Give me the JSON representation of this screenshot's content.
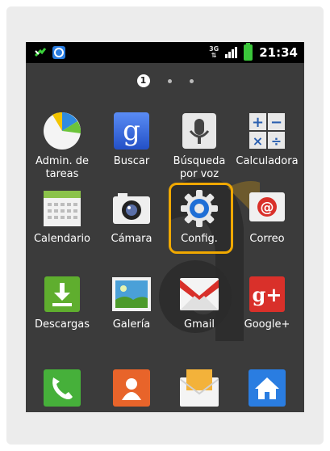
{
  "status_bar": {
    "network": "3G",
    "time": "21:34"
  },
  "pager": {
    "current_page": "1"
  },
  "apps": [
    {
      "label": "Admin. de tareas",
      "icon": "pie-chart-icon"
    },
    {
      "label": "Buscar",
      "icon": "google-search-icon"
    },
    {
      "label": "Búsqueda por voz",
      "icon": "microphone-icon"
    },
    {
      "label": "Calculadora",
      "icon": "calculator-icon"
    },
    {
      "label": "Calendario",
      "icon": "calendar-icon"
    },
    {
      "label": "Cámara",
      "icon": "camera-icon"
    },
    {
      "label": "Config.",
      "icon": "gear-icon"
    },
    {
      "label": "Correo",
      "icon": "email-icon"
    },
    {
      "label": "Descargas",
      "icon": "download-icon"
    },
    {
      "label": "Galería",
      "icon": "gallery-icon"
    },
    {
      "label": "Gmail",
      "icon": "gmail-icon"
    },
    {
      "label": "Google+",
      "icon": "google-plus-icon"
    },
    {
      "label": "",
      "icon": "phone-icon"
    },
    {
      "label": "",
      "icon": "contacts-icon"
    },
    {
      "label": "",
      "icon": "messaging-icon"
    },
    {
      "label": "",
      "icon": "home-icon"
    }
  ],
  "highlight_color": "#f0a800",
  "calculator": {
    "plus": "+",
    "minus": "−",
    "times": "×",
    "divide": "÷"
  },
  "google_search_letter": "g",
  "google_plus_text": "g+"
}
